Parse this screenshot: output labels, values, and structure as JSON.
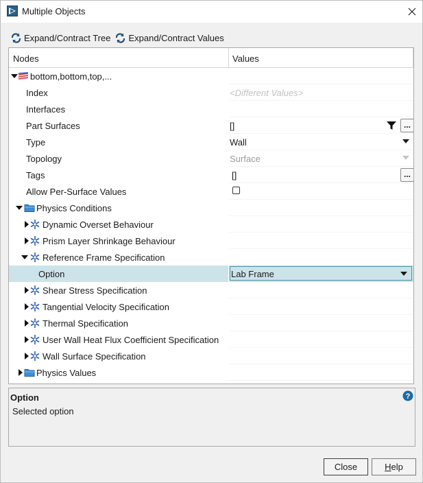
{
  "window": {
    "title": "Multiple Objects"
  },
  "toolbar": {
    "expand_tree_label": "Expand/Contract Tree",
    "expand_values_label": "Expand/Contract Values"
  },
  "tree": {
    "header": {
      "nodes": "Nodes",
      "values": "Values"
    },
    "rows": [
      {
        "label": "bottom,bottom,top,...",
        "value": ""
      },
      {
        "label": "Index",
        "value": "<Different Values>"
      },
      {
        "label": "Interfaces",
        "value": ""
      },
      {
        "label": "Part Surfaces",
        "value": "[]"
      },
      {
        "label": "Type",
        "value": "Wall"
      },
      {
        "label": "Topology",
        "value": "Surface"
      },
      {
        "label": "Tags",
        "value": "[]"
      },
      {
        "label": "Allow Per-Surface Values",
        "value": ""
      },
      {
        "label": "Physics Conditions",
        "value": ""
      },
      {
        "label": "Dynamic Overset Behaviour",
        "value": ""
      },
      {
        "label": "Prism Layer Shrinkage Behaviour",
        "value": ""
      },
      {
        "label": "Reference Frame Specification",
        "value": ""
      },
      {
        "label": "Option",
        "value": "Lab Frame"
      },
      {
        "label": "Shear Stress Specification",
        "value": ""
      },
      {
        "label": "Tangential Velocity Specification",
        "value": ""
      },
      {
        "label": "Thermal Specification",
        "value": ""
      },
      {
        "label": "User Wall Heat Flux Coefficient Specification",
        "value": ""
      },
      {
        "label": "Wall Surface Specification",
        "value": ""
      },
      {
        "label": "Physics Values",
        "value": ""
      }
    ],
    "part_surfaces_filter_icon": "filter-icon",
    "ellipsis_label": "..."
  },
  "info": {
    "title": "Option",
    "description": "Selected option"
  },
  "buttons": {
    "close_label": "Close",
    "help_label": "Help"
  },
  "colors": {
    "selection": "#cde3ea",
    "accent": "#1c6aa6"
  }
}
